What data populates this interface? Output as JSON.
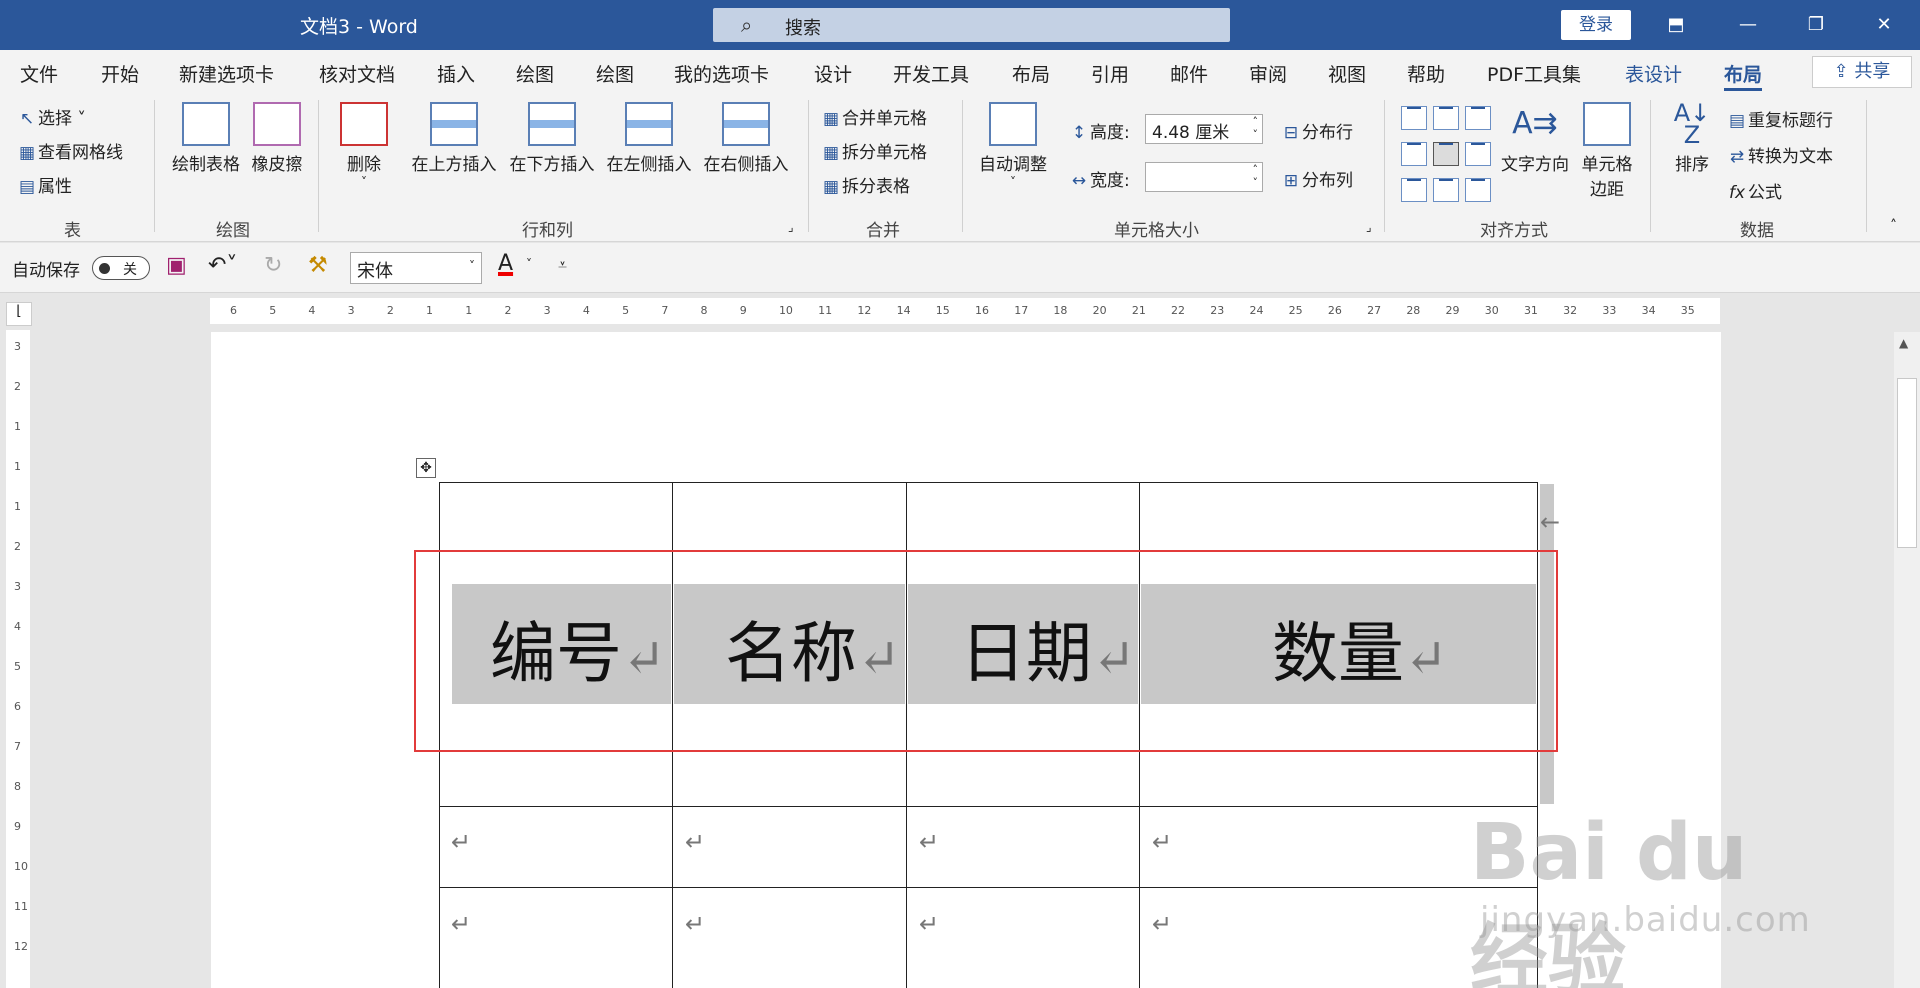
{
  "titlebar": {
    "doc_title": "文档3  -  Word",
    "search_placeholder": "搜索",
    "login": "登录",
    "minimize": "—",
    "restore": "❐",
    "close": "✕",
    "ribbon_display": "⬒"
  },
  "tabs": [
    "文件",
    "开始",
    "新建选项卡",
    "核对文档",
    "插入",
    "绘图",
    "绘图",
    "我的选项卡",
    "设计",
    "开发工具",
    "布局",
    "引用",
    "邮件",
    "审阅",
    "视图",
    "帮助",
    "PDF工具集",
    "表设计",
    "布局"
  ],
  "share": "共享",
  "ribbon": {
    "table_group": {
      "select": "选择",
      "view_gridlines": "查看网格线",
      "properties": "属性",
      "label": "表"
    },
    "draw_group": {
      "draw_table": "绘制表格",
      "eraser": "橡皮擦",
      "label": "绘图"
    },
    "rowcol_group": {
      "delete": "删除",
      "insert_above": "在上方插入",
      "insert_below": "在下方插入",
      "insert_left": "在左侧插入",
      "insert_right": "在右侧插入",
      "label": "行和列"
    },
    "merge_group": {
      "merge_cells": "合并单元格",
      "split_cells": "拆分单元格",
      "split_table": "拆分表格",
      "label": "合并"
    },
    "size_group": {
      "autofit": "自动调整",
      "height_label": "高度:",
      "height_value": "4.48 厘米",
      "width_label": "宽度:",
      "width_value": "",
      "dist_rows": "分布行",
      "dist_cols": "分布列",
      "label": "单元格大小"
    },
    "align_group": {
      "text_direction": "文字方向",
      "cell_margins_1": "单元格",
      "cell_margins_2": "边距",
      "label": "对齐方式"
    },
    "data_group": {
      "sort": "排序",
      "repeat_header": "重复标题行",
      "convert_text": "转换为文本",
      "formula": "公式",
      "label": "数据"
    }
  },
  "qat": {
    "autosave": "自动保存",
    "autosave_state": "关",
    "font": "宋体"
  },
  "hruler_ticks": [
    "6",
    "5",
    "4",
    "3",
    "2",
    "1",
    "1",
    "2",
    "3",
    "4",
    "5",
    "7",
    "8",
    "9",
    "10",
    "11",
    "12",
    "14",
    "15",
    "16",
    "17",
    "18",
    "20",
    "21",
    "22",
    "23",
    "24",
    "25",
    "26",
    "27",
    "28",
    "29",
    "30",
    "31",
    "32",
    "33",
    "34",
    "35"
  ],
  "vruler_ticks": [
    "3",
    "2",
    "1",
    "1",
    "1",
    "2",
    "3",
    "4",
    "5",
    "6",
    "7",
    "8",
    "9",
    "10",
    "11",
    "12"
  ],
  "table": {
    "headers": [
      "编号",
      "名称",
      "日期",
      "数量"
    ],
    "return_mark": "↵"
  },
  "watermark": {
    "brand": "Bai du 经验",
    "url": "jingyan.baidu.com"
  }
}
